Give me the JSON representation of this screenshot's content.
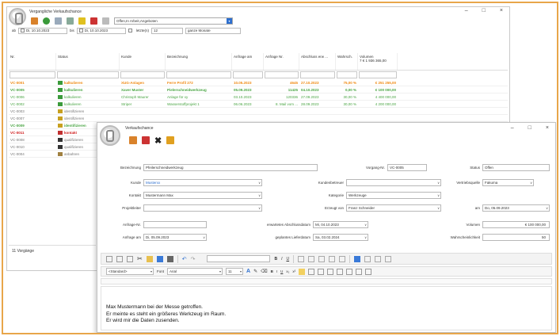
{
  "back_window": {
    "title": "Vergangliche Verkaufschance",
    "filter_combo": "Offen,In Arbeit,Angeboten",
    "from_label": "ab",
    "from_date": "Di, 10.10.2023",
    "to_label": "bis",
    "to_date": "Di, 10.10.2023",
    "last_n_label": "letzte(n)",
    "last_n_value": "12",
    "period_unit": "ganze Monate",
    "columns": [
      "Nr.",
      "Status",
      "Kunde",
      "Bezeichnung",
      "Anfrage am",
      "Anfrage Nr.",
      "Abschluss erw ...",
      "Wahrsch.",
      "Volumen"
    ],
    "volume_total": "7 € 1 936 365,00",
    "rows": [
      {
        "nr": "VC-0001",
        "status": "kalkulieren",
        "kunde": "XUG-Anlagen",
        "bez": "Ferre Profil 272",
        "anfrage_am": "10.05.2023",
        "anfrage_nr": "4645",
        "abschluss": "27.10.2023",
        "wahr": "75,00 %",
        "vol": "€ 251 255,00",
        "style": "orange"
      },
      {
        "nr": "VC-0005",
        "status": "kalkulieren",
        "kunde": "Xaver Muster",
        "bez": "Pielerschneidwerkzeug",
        "anfrage_am": "05.09.2023",
        "anfrage_nr": "11425",
        "abschluss": "04.10.2023",
        "wahr": "0,00 %",
        "vol": "€ 100 000,00",
        "style": "green-bold"
      },
      {
        "nr": "VC-0006",
        "status": "kalkulieren",
        "kunde": "Christoph Maurer",
        "bez": "Anlage für xy",
        "anfrage_am": "03.10.2023",
        "anfrage_nr": "120336",
        "abschluss": "27.09.2023",
        "wahr": "30,00 %",
        "vol": "4 400 000,00",
        "style": "green"
      },
      {
        "nr": "VC-0002",
        "status": "kalkulieren",
        "kunde": "Striper",
        "bez": "Wasserstoffprojekt 1",
        "anfrage_am": "06.06.2023",
        "anfrage_nr": "8. Mail vom ...",
        "abschluss": "28.09.2023",
        "wahr": "30,00 %",
        "vol": "4 200 000,00",
        "style": "green"
      },
      {
        "nr": "VC-0003",
        "status": "identifizieren",
        "kunde": "",
        "bez": "",
        "anfrage_am": "",
        "anfrage_nr": "",
        "abschluss": "",
        "wahr": "",
        "vol": "",
        "style": "gray"
      },
      {
        "nr": "VC-0007",
        "status": "identifizieren",
        "kunde": "",
        "bez": "",
        "anfrage_am": "",
        "anfrage_nr": "",
        "abschluss": "",
        "wahr": "",
        "vol": "",
        "style": "gray"
      },
      {
        "nr": "VC-0009",
        "status": "identifizieren",
        "kunde": "",
        "bez": "",
        "anfrage_am": "",
        "anfrage_nr": "",
        "abschluss": "",
        "wahr": "",
        "vol": "",
        "style": "green-bold"
      },
      {
        "nr": "VC-0011",
        "status": "kontakt",
        "kunde": "",
        "bez": "",
        "anfrage_am": "",
        "anfrage_nr": "",
        "abschluss": "",
        "wahr": "",
        "vol": "",
        "style": "red"
      },
      {
        "nr": "VC-0008",
        "status": "qualifizieren",
        "kunde": "",
        "bez": "",
        "anfrage_am": "",
        "anfrage_nr": "",
        "abschluss": "",
        "wahr": "",
        "vol": "",
        "style": "gray"
      },
      {
        "nr": "VC-0010",
        "status": "qualifizieren",
        "kunde": "",
        "bez": "",
        "anfrage_am": "",
        "anfrage_nr": "",
        "abschluss": "",
        "wahr": "",
        "vol": "",
        "style": "gray"
      },
      {
        "nr": "VC-0004",
        "status": "anbahren",
        "kunde": "",
        "bez": "",
        "anfrage_am": "",
        "anfrage_nr": "",
        "abschluss": "",
        "wahr": "",
        "vol": "",
        "style": "gray"
      }
    ],
    "count_label": "11 Vorgänge"
  },
  "front_window": {
    "title": "Verkaufschance",
    "bezeichnung_label": "Bezeichnung",
    "bezeichnung_value": "Pfeilerschneidwerkzeug",
    "vorgang_label": "Vorgang-Nr.",
    "vorgang_value": "VC-0005",
    "status_label": "Status",
    "status_value": "Offen",
    "kunde_label": "Kunde",
    "kunde_value": "Musterxx",
    "kundenbetreuer_label": "Kundenbetreuer",
    "vertriebsquelle_label": "Vertriebsquelle",
    "vertriebsquelle_value": "Fakuma",
    "kontakt_label": "Kontakt",
    "kontakt_value": "Mustermann Max",
    "kategorie_label": "Kategorie",
    "kategorie_value": "Werkzeuge",
    "projektleiter_label": "Projektleiter",
    "erzeugt_label": "Erzeugt von",
    "erzeugt_value": "Franz Schneider",
    "am_label": "am",
    "am_value": "Do, 05.09.2023",
    "anfrage_nr_label": "Anfrage-Nr.",
    "erw_abschluss_label": "erwartetes Abschlussdatum",
    "erw_abschluss_value": "Mi, 04.10.2023",
    "volumen_label": "Volumen",
    "volumen_value": "€ 100 000,00",
    "anfrage_am_label": "Anfrage am",
    "anfrage_am_value": "Di, 05.09.2023",
    "liefer_label": "geplantes Lieferdatum",
    "liefer_value": "Sa, 03.02.2024",
    "wahr_label": "Wahrscheinlichkeit",
    "wahr_value": "50",
    "style_combo": "<Standard>",
    "font_label": "Font",
    "font_value": "Arial",
    "size_value": "11",
    "editor_lines": [
      "Max Mustermann bei der Messe getroffen.",
      "Er meinte es steht ein größeres Werkzeug im Raum.",
      "Er wird mir die Daten zusenden."
    ]
  },
  "colors": {
    "frame": "#e8a64a",
    "accent": "#2d6fcf",
    "orange": "#f08a13",
    "green": "#4aa544",
    "red": "#d02020"
  }
}
